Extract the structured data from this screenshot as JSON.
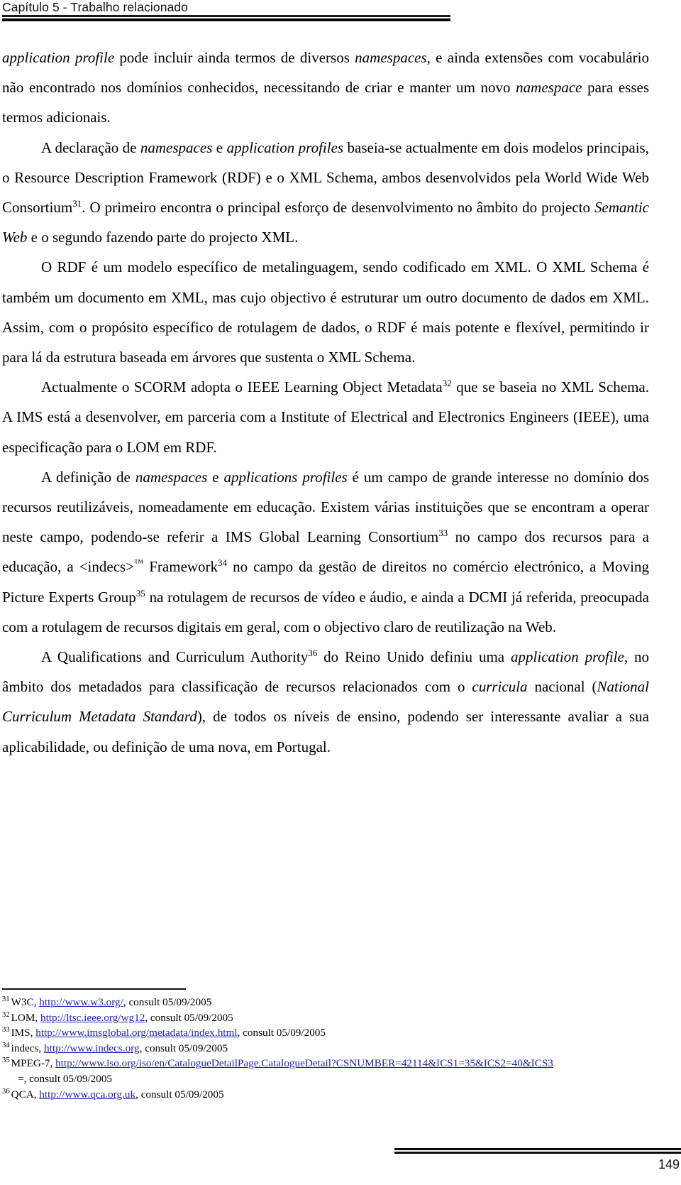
{
  "header": {
    "chapter_title": "Capítulo 5 - Trabalho relacionado"
  },
  "body": {
    "paragraphs": [
      {
        "id": "p-application-profile",
        "indent": false,
        "text": "application profile pode incluir ainda termos de diversos namespaces, e ainda extensões com vocabulário não encontrado nos domínios conhecidos, necessitando de criar e manter um novo namespace para esses termos adicionais."
      },
      {
        "id": "p-declaracao-namespaces",
        "indent": true,
        "text": "A declaração de namespaces e application profiles baseia-se actualmente em dois modelos principais, o Resource Description Framework (RDF) e o XML Schema, ambos desenvolvidos pela World Wide Web Consortium31. O primeiro encontra o principal esforço de desenvolvimento no âmbito do projecto Semantic Web e o segundo fazendo parte do projecto XML."
      },
      {
        "id": "p-rdf-modelo",
        "indent": true,
        "text": "O RDF é um modelo específico de metalinguagem, sendo codificado em XML. O XML Schema é também um documento em XML, mas cujo objectivo é estruturar um outro documento de dados em XML. Assim, com o propósito específico de rotulagem de dados, o RDF é mais potente e flexível, permitindo ir para lá da estrutura baseada em árvores que sustenta o XML Schema."
      },
      {
        "id": "p-scorm-ieee",
        "indent": true,
        "text": "Actualmente o SCORM adopta o IEEE Learning Object Metadata32 que se baseia no XML Schema. A IMS está a desenvolver, em parceria com a Institute of Electrical and Electronics Engineers (IEEE), uma especificação para o LOM em RDF."
      },
      {
        "id": "p-definicao-namespaces",
        "indent": true,
        "text": "A definição de namespaces e applications profiles é um campo de grande interesse no domínio dos recursos reutilizáveis, nomeadamente em educação. Existem várias instituições que se encontram a operar neste campo, podendo-se referir a IMS Global Learning Consortium33 no campo dos recursos para a educação, a <indecs>™ Framework34 no campo da gestão de direitos no comércio electrónico, a Moving Picture Experts Group35 na rotulagem de recursos de vídeo e áudio, e ainda a DCMI já referida, preocupada com a rotulagem de recursos digitais em geral, com o objectivo claro de reutilização na Web."
      },
      {
        "id": "p-qca",
        "indent": true,
        "text": "A Qualifications and Curriculum Authority36 do Reino Unido definiu uma application profile, no âmbito dos metadados para classificação de recursos relacionados com o curricula nacional (National Curriculum Metadata Standard), de todos os níveis de ensino, podendo ser interessante avaliar a sua aplicabilidade, ou definição de uma nova, em Portugal."
      }
    ],
    "fragments": {
      "p1": {
        "i1": "application profile",
        "t1": " pode incluir ainda termos de diversos ",
        "i2": "namespaces",
        "t2": ", e ainda extensões com vocabulário não encontrado nos domínios conhecidos, necessitando de criar e manter um novo ",
        "i3": "namespace",
        "t3": " para esses termos adicionais."
      },
      "p2": {
        "t1": "A declaração de ",
        "i1": "namespaces",
        "t2": " e ",
        "i2": "application profiles",
        "t3": " baseia-se actualmente em dois modelos principais, o Resource Description Framework (RDF) e o XML Schema, ambos desenvolvidos pela World Wide Web Consortium",
        "sup1": "31",
        "t4": ". O primeiro encontra o principal esforço de desenvolvimento no âmbito do projecto ",
        "i3": "Semantic Web",
        "t5": " e o segundo fazendo parte do projecto XML."
      },
      "p3": {
        "t1": "O RDF é um modelo específico de metalinguagem, sendo codificado em XML. O XML Schema é também um documento em XML, mas cujo objectivo é estruturar um outro documento de dados em XML. Assim, com o propósito específico de rotulagem de dados, o RDF é mais potente e flexível, permitindo ir para lá da estrutura baseada em árvores que sustenta o XML Schema."
      },
      "p4": {
        "t1": "Actualmente o SCORM adopta o IEEE Learning Object Metadata",
        "sup1": "32",
        "t2": " que se baseia no XML Schema. A IMS está a desenvolver, em parceria com a Institute of Electrical and Electronics Engineers (IEEE), uma especificação para o LOM em RDF."
      },
      "p5": {
        "t1": "A definição de ",
        "i1": "namespaces",
        "t2": " e ",
        "i2": "applications profiles",
        "t3": " é um campo de grande interesse no domínio dos recursos reutilizáveis, nomeadamente em educação. Existem várias instituições que se encontram a operar neste campo, podendo-se referir a IMS Global Learning Consortium",
        "sup1": "33",
        "t4": " no campo dos recursos para a educação, a <indecs>",
        "tm": "™",
        "t5": " Framework",
        "sup2": "34",
        "t6": " no campo da gestão de direitos no comércio electrónico, a Moving Picture Experts Group",
        "sup3": "35",
        "t7": " na rotulagem de recursos de vídeo e áudio, e ainda a DCMI já referida, preocupada com a rotulagem de recursos digitais em geral, com o objectivo claro de reutilização na Web."
      },
      "p6": {
        "t1": "A Qualifications and Curriculum Authority",
        "sup1": "36",
        "t2": " do Reino Unido definiu uma ",
        "i1": "application profile",
        "t3": ", no âmbito dos metadados para classificação de recursos relacionados com o ",
        "i2": "curricula",
        "t4": " nacional (",
        "i3": "National Curriculum Metadata Standard",
        "t5": "), de todos os níveis de ensino, podendo ser interessante avaliar a sua aplicabilidade, ou definição de uma nova, em Portugal."
      }
    }
  },
  "footnotes": [
    {
      "number": "31",
      "source": "W3C, ",
      "url": "http://www.w3.org/",
      "consult": ", consult 05/09/2005"
    },
    {
      "number": "32",
      "source": "LOM, ",
      "url": "http://ltsc.ieee.org/wg12",
      "consult": ", consult 05/09/2005"
    },
    {
      "number": "33",
      "source": "IMS, ",
      "url": "http://www.imsglobal.org/metadata/index.html",
      "consult": ", consult 05/09/2005"
    },
    {
      "number": "34",
      "source": "indecs, ",
      "url": "http://www.indecs.org",
      "consult": ", consult 05/09/2005"
    },
    {
      "number": "35",
      "source": "MPEG-7, ",
      "url": "http://www.iso.org/iso/en/CatalogueDetailPage.CatalogueDetail?CSNUMBER=42114&ICS1=35&ICS2=40&ICS3",
      "url_tail": "=",
      "consult": ", consult 05/09/2005"
    },
    {
      "number": "36",
      "source": "QCA, ",
      "url": "http://www.qca.org.uk",
      "consult": ", consult 05/09/2005"
    }
  ],
  "footer": {
    "page_number": "149"
  },
  "colors": {
    "link": "#2222bb",
    "text": "#000000",
    "rule": "#0a0a0a",
    "background": "#ffffff"
  }
}
